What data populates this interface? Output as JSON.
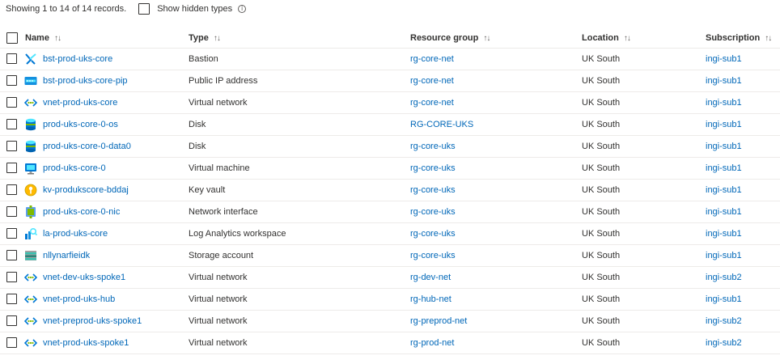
{
  "toolbar": {
    "records_text": "Showing 1 to 14 of 14 records.",
    "show_hidden_label": "Show hidden types",
    "info_glyph": "i"
  },
  "columns": {
    "name": "Name",
    "type": "Type",
    "resource_group": "Resource group",
    "location": "Location",
    "subscription": "Subscription",
    "sort_glyph": "↑↓"
  },
  "rows": [
    {
      "name": "bst-prod-uks-core",
      "type": "Bastion",
      "resource_group": "rg-core-net",
      "location": "UK South",
      "subscription": "ingi-sub1",
      "icon": "bastion-icon"
    },
    {
      "name": "bst-prod-uks-core-pip",
      "type": "Public IP address",
      "resource_group": "rg-core-net",
      "location": "UK South",
      "subscription": "ingi-sub1",
      "icon": "public-ip-icon"
    },
    {
      "name": "vnet-prod-uks-core",
      "type": "Virtual network",
      "resource_group": "rg-core-net",
      "location": "UK South",
      "subscription": "ingi-sub1",
      "icon": "vnet-icon"
    },
    {
      "name": "prod-uks-core-0-os",
      "type": "Disk",
      "resource_group": "RG-CORE-UKS",
      "location": "UK South",
      "subscription": "ingi-sub1",
      "icon": "disk-icon"
    },
    {
      "name": "prod-uks-core-0-data0",
      "type": "Disk",
      "resource_group": "rg-core-uks",
      "location": "UK South",
      "subscription": "ingi-sub1",
      "icon": "disk-icon"
    },
    {
      "name": "prod-uks-core-0",
      "type": "Virtual machine",
      "resource_group": "rg-core-uks",
      "location": "UK South",
      "subscription": "ingi-sub1",
      "icon": "vm-icon"
    },
    {
      "name": "kv-produkscore-bddaj",
      "type": "Key vault",
      "resource_group": "rg-core-uks",
      "location": "UK South",
      "subscription": "ingi-sub1",
      "icon": "key-vault-icon"
    },
    {
      "name": "prod-uks-core-0-nic",
      "type": "Network interface",
      "resource_group": "rg-core-uks",
      "location": "UK South",
      "subscription": "ingi-sub1",
      "icon": "nic-icon"
    },
    {
      "name": "la-prod-uks-core",
      "type": "Log Analytics workspace",
      "resource_group": "rg-core-uks",
      "location": "UK South",
      "subscription": "ingi-sub1",
      "icon": "log-analytics-icon"
    },
    {
      "name": "nllynarfieidk",
      "type": "Storage account",
      "resource_group": "rg-core-uks",
      "location": "UK South",
      "subscription": "ingi-sub1",
      "icon": "storage-icon"
    },
    {
      "name": "vnet-dev-uks-spoke1",
      "type": "Virtual network",
      "resource_group": "rg-dev-net",
      "location": "UK South",
      "subscription": "ingi-sub2",
      "icon": "vnet-icon"
    },
    {
      "name": "vnet-prod-uks-hub",
      "type": "Virtual network",
      "resource_group": "rg-hub-net",
      "location": "UK South",
      "subscription": "ingi-sub1",
      "icon": "vnet-icon"
    },
    {
      "name": "vnet-preprod-uks-spoke1",
      "type": "Virtual network",
      "resource_group": "rg-preprod-net",
      "location": "UK South",
      "subscription": "ingi-sub2",
      "icon": "vnet-icon"
    },
    {
      "name": "vnet-prod-uks-spoke1",
      "type": "Virtual network",
      "resource_group": "rg-prod-net",
      "location": "UK South",
      "subscription": "ingi-sub2",
      "icon": "vnet-icon"
    }
  ]
}
